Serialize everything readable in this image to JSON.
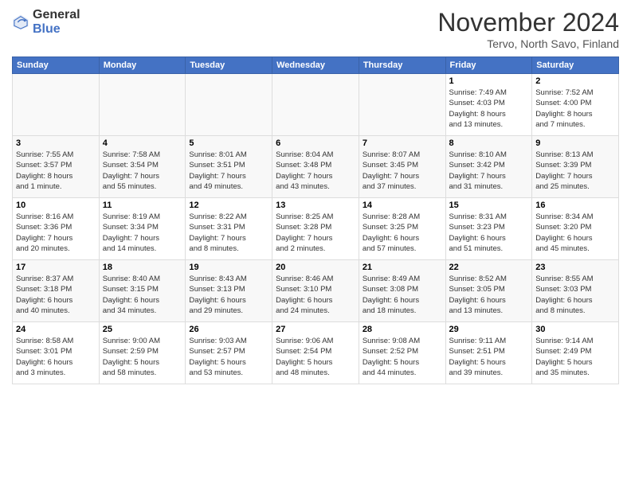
{
  "header": {
    "logo_general": "General",
    "logo_blue": "Blue",
    "title": "November 2024",
    "location": "Tervo, North Savo, Finland"
  },
  "days_of_week": [
    "Sunday",
    "Monday",
    "Tuesday",
    "Wednesday",
    "Thursday",
    "Friday",
    "Saturday"
  ],
  "weeks": [
    [
      {
        "day": "",
        "info": ""
      },
      {
        "day": "",
        "info": ""
      },
      {
        "day": "",
        "info": ""
      },
      {
        "day": "",
        "info": ""
      },
      {
        "day": "",
        "info": ""
      },
      {
        "day": "1",
        "info": "Sunrise: 7:49 AM\nSunset: 4:03 PM\nDaylight: 8 hours\nand 13 minutes."
      },
      {
        "day": "2",
        "info": "Sunrise: 7:52 AM\nSunset: 4:00 PM\nDaylight: 8 hours\nand 7 minutes."
      }
    ],
    [
      {
        "day": "3",
        "info": "Sunrise: 7:55 AM\nSunset: 3:57 PM\nDaylight: 8 hours\nand 1 minute."
      },
      {
        "day": "4",
        "info": "Sunrise: 7:58 AM\nSunset: 3:54 PM\nDaylight: 7 hours\nand 55 minutes."
      },
      {
        "day": "5",
        "info": "Sunrise: 8:01 AM\nSunset: 3:51 PM\nDaylight: 7 hours\nand 49 minutes."
      },
      {
        "day": "6",
        "info": "Sunrise: 8:04 AM\nSunset: 3:48 PM\nDaylight: 7 hours\nand 43 minutes."
      },
      {
        "day": "7",
        "info": "Sunrise: 8:07 AM\nSunset: 3:45 PM\nDaylight: 7 hours\nand 37 minutes."
      },
      {
        "day": "8",
        "info": "Sunrise: 8:10 AM\nSunset: 3:42 PM\nDaylight: 7 hours\nand 31 minutes."
      },
      {
        "day": "9",
        "info": "Sunrise: 8:13 AM\nSunset: 3:39 PM\nDaylight: 7 hours\nand 25 minutes."
      }
    ],
    [
      {
        "day": "10",
        "info": "Sunrise: 8:16 AM\nSunset: 3:36 PM\nDaylight: 7 hours\nand 20 minutes."
      },
      {
        "day": "11",
        "info": "Sunrise: 8:19 AM\nSunset: 3:34 PM\nDaylight: 7 hours\nand 14 minutes."
      },
      {
        "day": "12",
        "info": "Sunrise: 8:22 AM\nSunset: 3:31 PM\nDaylight: 7 hours\nand 8 minutes."
      },
      {
        "day": "13",
        "info": "Sunrise: 8:25 AM\nSunset: 3:28 PM\nDaylight: 7 hours\nand 2 minutes."
      },
      {
        "day": "14",
        "info": "Sunrise: 8:28 AM\nSunset: 3:25 PM\nDaylight: 6 hours\nand 57 minutes."
      },
      {
        "day": "15",
        "info": "Sunrise: 8:31 AM\nSunset: 3:23 PM\nDaylight: 6 hours\nand 51 minutes."
      },
      {
        "day": "16",
        "info": "Sunrise: 8:34 AM\nSunset: 3:20 PM\nDaylight: 6 hours\nand 45 minutes."
      }
    ],
    [
      {
        "day": "17",
        "info": "Sunrise: 8:37 AM\nSunset: 3:18 PM\nDaylight: 6 hours\nand 40 minutes."
      },
      {
        "day": "18",
        "info": "Sunrise: 8:40 AM\nSunset: 3:15 PM\nDaylight: 6 hours\nand 34 minutes."
      },
      {
        "day": "19",
        "info": "Sunrise: 8:43 AM\nSunset: 3:13 PM\nDaylight: 6 hours\nand 29 minutes."
      },
      {
        "day": "20",
        "info": "Sunrise: 8:46 AM\nSunset: 3:10 PM\nDaylight: 6 hours\nand 24 minutes."
      },
      {
        "day": "21",
        "info": "Sunrise: 8:49 AM\nSunset: 3:08 PM\nDaylight: 6 hours\nand 18 minutes."
      },
      {
        "day": "22",
        "info": "Sunrise: 8:52 AM\nSunset: 3:05 PM\nDaylight: 6 hours\nand 13 minutes."
      },
      {
        "day": "23",
        "info": "Sunrise: 8:55 AM\nSunset: 3:03 PM\nDaylight: 6 hours\nand 8 minutes."
      }
    ],
    [
      {
        "day": "24",
        "info": "Sunrise: 8:58 AM\nSunset: 3:01 PM\nDaylight: 6 hours\nand 3 minutes."
      },
      {
        "day": "25",
        "info": "Sunrise: 9:00 AM\nSunset: 2:59 PM\nDaylight: 5 hours\nand 58 minutes."
      },
      {
        "day": "26",
        "info": "Sunrise: 9:03 AM\nSunset: 2:57 PM\nDaylight: 5 hours\nand 53 minutes."
      },
      {
        "day": "27",
        "info": "Sunrise: 9:06 AM\nSunset: 2:54 PM\nDaylight: 5 hours\nand 48 minutes."
      },
      {
        "day": "28",
        "info": "Sunrise: 9:08 AM\nSunset: 2:52 PM\nDaylight: 5 hours\nand 44 minutes."
      },
      {
        "day": "29",
        "info": "Sunrise: 9:11 AM\nSunset: 2:51 PM\nDaylight: 5 hours\nand 39 minutes."
      },
      {
        "day": "30",
        "info": "Sunrise: 9:14 AM\nSunset: 2:49 PM\nDaylight: 5 hours\nand 35 minutes."
      }
    ]
  ]
}
